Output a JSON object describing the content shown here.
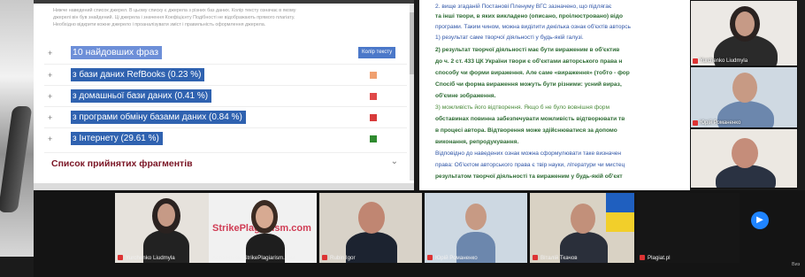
{
  "left_doc": {
    "intro_lines": [
      "Нижче наведений список джерел. В цьому списку є джерела з різних баз даних. Колір тексту означає в якому",
      "джерелі він був знайдений. Ці джерела і значення Коефіцієнту Подібності не відображають прямого плагіату.",
      "Необхідно відкрити кожне джерело і проаналізувати зміст і правильність оформлення джерела."
    ],
    "header_label": "10 найдовших фраз",
    "color_header": "Колір тексту",
    "sources": [
      {
        "label": "з бази даних RefBooks (0.23 %)",
        "color": "#f0a070"
      },
      {
        "label": "з домашньої бази даних (0.41 %)",
        "color": "#e04848"
      },
      {
        "label": "з програми обміну базами даних (0.84 %)",
        "color": "#d83a3a"
      },
      {
        "label": "з Інтернету (29.61 %)",
        "color": "#2f8a2f"
      }
    ],
    "accepted_title": "Список прийнятих фрагментів"
  },
  "right_doc": {
    "lines": [
      "2. вище згаданій  Постанові  Пленуму ВГС зазначено, що підлягає",
      "та інші твори, в яких викладено (описано, проілюстровано) відо",
      "програми. Таким чином, можна виділити декілька ознак об'єктів авторсь",
      "1) результат саме творчої діяльності у будь-якій галузі.",
      "2)  результат  творчої діяльності має бути вираженим в об'єктив",
      "до ч. 2 ст. 433 ЦК України твори є об'єктами авторського  права  н",
      "способу чи форми вираження. Але саме «вираження» (тобто - фор",
      "Спосіб чи форма вираження можуть бути різними: усний вираз,",
      "об'ємне зображення.",
      "3) можливість  його  відтворення. Якщо б не  було  вовнішня форм",
      "обставинах повинна забезпечувати можливість відтворювати тв",
      "в процесі автора.   Відтворення може здійснюватися за допомо",
      "виконання, репродукування.",
      "Відповідно до наведених ознак можна сформулювати таке визначен",
      "права: Об'єктом авторського права є твір науки, літератури чи мистец",
      "результатом творчої діяльності  та  вираженим у будь-якій об'єкт"
    ]
  },
  "side_participants": [
    {
      "name": "Yurchenko Liudmyla",
      "skin": "#c69a86",
      "bg": "#e9e6e2",
      "hair": "#2a2220"
    },
    {
      "name": "Юрій Романенко",
      "skin": "#c79a84",
      "bg": "#cfd9e2",
      "hair": "#3a2c24"
    },
    {
      "name": "",
      "skin": "#c58d7a",
      "bg": "#ece8e2",
      "hair": "#6b5a4a"
    }
  ],
  "gallery": {
    "participants": [
      {
        "name": "Yurchenko Liudmyla"
      },
      {
        "name": "Anna Hrijak, StrikePlagiarism.com"
      },
      {
        "name": "Rubin Igor"
      },
      {
        "name": "Юрій Романенко"
      },
      {
        "name": "Віталій Ткачов"
      },
      {
        "name": "Plagiat.pl"
      }
    ],
    "brand_text": "StrikePlagiarism.com",
    "next_icon": "▶",
    "corner_text": "Виз"
  }
}
